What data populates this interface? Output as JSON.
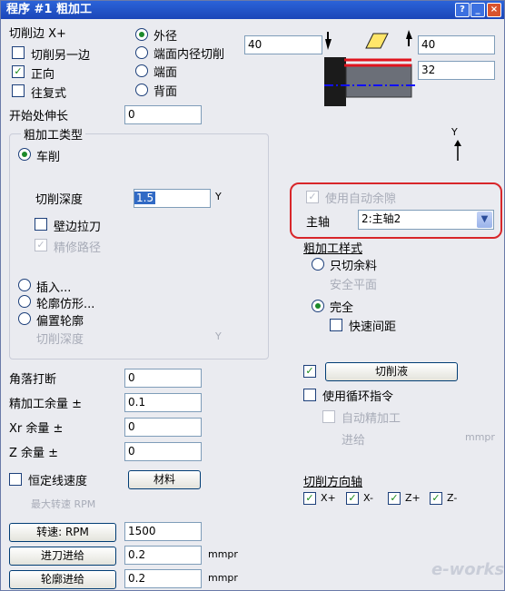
{
  "title": "程序 #1 粗加工",
  "left": {
    "cut_edge_label": "切削边 X+",
    "cut_other_side": "切削另一边",
    "forward": "正向",
    "reciprocating": "往复式",
    "start_extend_label": "开始处伸长",
    "start_extend_value": "0",
    "rough_type_title": "粗加工类型",
    "turning": "车削",
    "cut_depth_label": "切削深度",
    "cut_depth_value": "1.5",
    "cut_depth_unit": "Y",
    "wall_pull": "壁边拉刀",
    "finish_path": "精修路径",
    "plunge": "插入...",
    "profile_follow": "轮廓仿形...",
    "offset_profile": "偏置轮廓",
    "cut_depth2_label": "切削深度",
    "cut_depth2_unit": "Y",
    "corner_break_label": "角落打断",
    "corner_break_value": "0",
    "finish_allow_label": "精加工余量 ±",
    "finish_allow_value": "0.1",
    "xr_allow_label": "Xr 余量 ±",
    "xr_allow_value": "0",
    "z_allow_label": "Z 余量 ±",
    "z_allow_value": "0",
    "const_speed": "恒定线速度",
    "material_button": "材料",
    "max_speed_label": "最大转速 RPM",
    "speed_button": "转速: RPM",
    "speed_value": "1500",
    "feed_button": "进刀进给",
    "feed_value": "0.2",
    "feed_unit": "mmpr",
    "profile_feed_button": "轮廓进给",
    "profile_feed_value": "0.2",
    "profile_feed_unit": "mmpr"
  },
  "mid": {
    "outer": "外径",
    "face_inner": "端面内径切削",
    "face": "端面",
    "back": "背面",
    "field1": "40"
  },
  "diagram": {
    "field_top": "40",
    "field_bottom": "32",
    "y_label": "Y"
  },
  "right": {
    "auto_allow": "使用自动余隙",
    "spindle_label": "主轴",
    "spindle_value": "2:主轴2",
    "rough_style_title": "粗加工样式",
    "only_cut": "只切余料",
    "safe_plane": "安全平面",
    "complete": "完全",
    "fast_gap": "快速间距",
    "coolant_button": "切削液",
    "use_cycle": "使用循环指令",
    "auto_finish": "自动精加工",
    "feed_in": "进给",
    "feed_in_unit": "mmpr",
    "cut_dir_title": "切削方向轴",
    "axes": [
      "X+",
      "X-",
      "Z+",
      "Z-"
    ]
  },
  "watermark": "e-works"
}
